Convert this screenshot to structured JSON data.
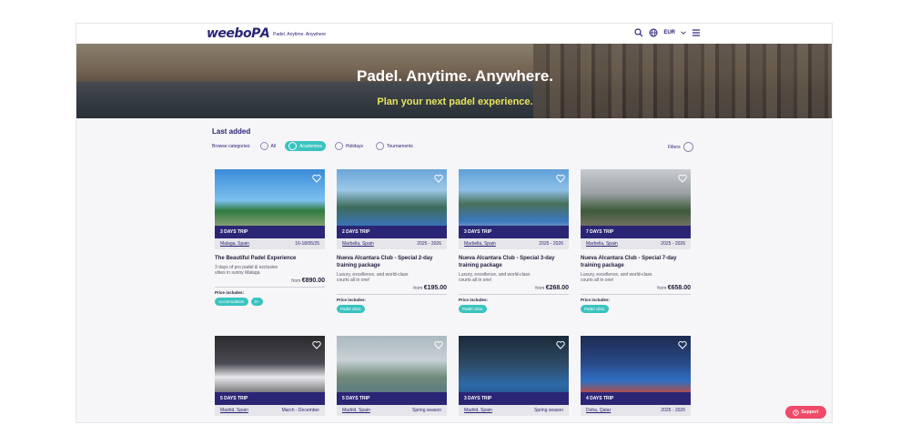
{
  "header": {
    "logo": "weeboРА",
    "tagline": "Padel. Anytime. Anywhere",
    "currency": "EUR"
  },
  "hero": {
    "title": "Padel. Anytime. Anywhere.",
    "subtitle": "Plan your next padel experience."
  },
  "section": {
    "title": "Last added",
    "browse_label": "Browse categories:",
    "categories": [
      "All",
      "Academies",
      "Holidays",
      "Tournaments"
    ],
    "filters_label": "Filters"
  },
  "cards": [
    {
      "band": "3 DAYS TRIP",
      "location": "Malaga, Spain",
      "dates": "16-18/05/25",
      "title": "The Beautiful Padel Experience",
      "desc": "3 days of pro padel & exclusive vibes in sunny Malaga",
      "from": "from",
      "price": "€890.00",
      "includes": "Price includes:",
      "tags": [
        "Accomodation",
        "3+"
      ]
    },
    {
      "band": "2 DAYS TRIP",
      "location": "Marbella, Spain",
      "dates": "2025 - 2026",
      "title": "Nueva Alcantara Club - Special 2-day training package",
      "desc": "Luxury, excellence, and world-class courts all in one!",
      "from": "from",
      "price": "€195.00",
      "includes": "Price includes:",
      "tags": [
        "Padel clinic"
      ]
    },
    {
      "band": "3 DAYS TRIP",
      "location": "Marbella, Spain",
      "dates": "2025 - 2026",
      "title": "Nueva Alcantara Club - Special 3-day training package",
      "desc": "Luxury, excellence, and world-class courts all in one!",
      "from": "from",
      "price": "€268.00",
      "includes": "Price includes:",
      "tags": [
        "Padel clinic"
      ]
    },
    {
      "band": "7 DAYS TRIP",
      "location": "Marbella, Spain",
      "dates": "2025 - 2026",
      "title": "Nueva Alcantara Club - Special 7-day training package",
      "desc": "Luxury, excellence, and world-class courts all in one!",
      "from": "from",
      "price": "€658.00",
      "includes": "Price includes:",
      "tags": [
        "Padel clinic"
      ]
    },
    {
      "band": "5 DAYS TRIP",
      "location": "Madrid, Spain",
      "dates": "March - December"
    },
    {
      "band": "5 DAYS TRIP",
      "location": "Madrid, Spain",
      "dates": "Spring season"
    },
    {
      "band": "3 DAYS TRIP",
      "location": "Madrid, Spain",
      "dates": "Spring season"
    },
    {
      "band": "4 DAYS TRIP",
      "location": "Doha, Qatar",
      "dates": "2025 - 2026"
    }
  ],
  "support_label": "Support",
  "colors": {
    "brand": "#2b2575",
    "accent": "#3ac3c0",
    "highlight": "#e8e35a",
    "support": "#ef4a6a"
  }
}
